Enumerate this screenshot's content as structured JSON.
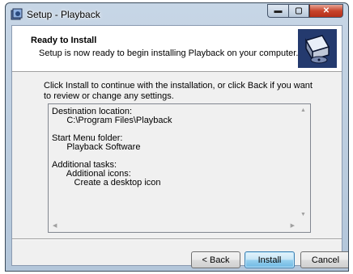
{
  "window": {
    "title": "Setup - Playback",
    "controls": {
      "minimize": "▬",
      "maximize": "▢",
      "close": "✕"
    }
  },
  "header": {
    "title": "Ready to Install",
    "subtitle": "Setup is now ready to begin installing Playback on your computer."
  },
  "intro_text": "Click Install to continue with the installation, or click Back if you want to review or change any settings.",
  "summary_memo": "Destination location:\n      C:\\Program Files\\Playback\n\nStart Menu folder:\n      Playback Software\n\nAdditional tasks:\n      Additional icons:\n         Create a desktop icon",
  "scroll_arrows": {
    "up": "▲",
    "down": "▼",
    "left": "◀",
    "right": "▶"
  },
  "buttons": {
    "back": "< Back",
    "install": "Install",
    "cancel": "Cancel"
  }
}
